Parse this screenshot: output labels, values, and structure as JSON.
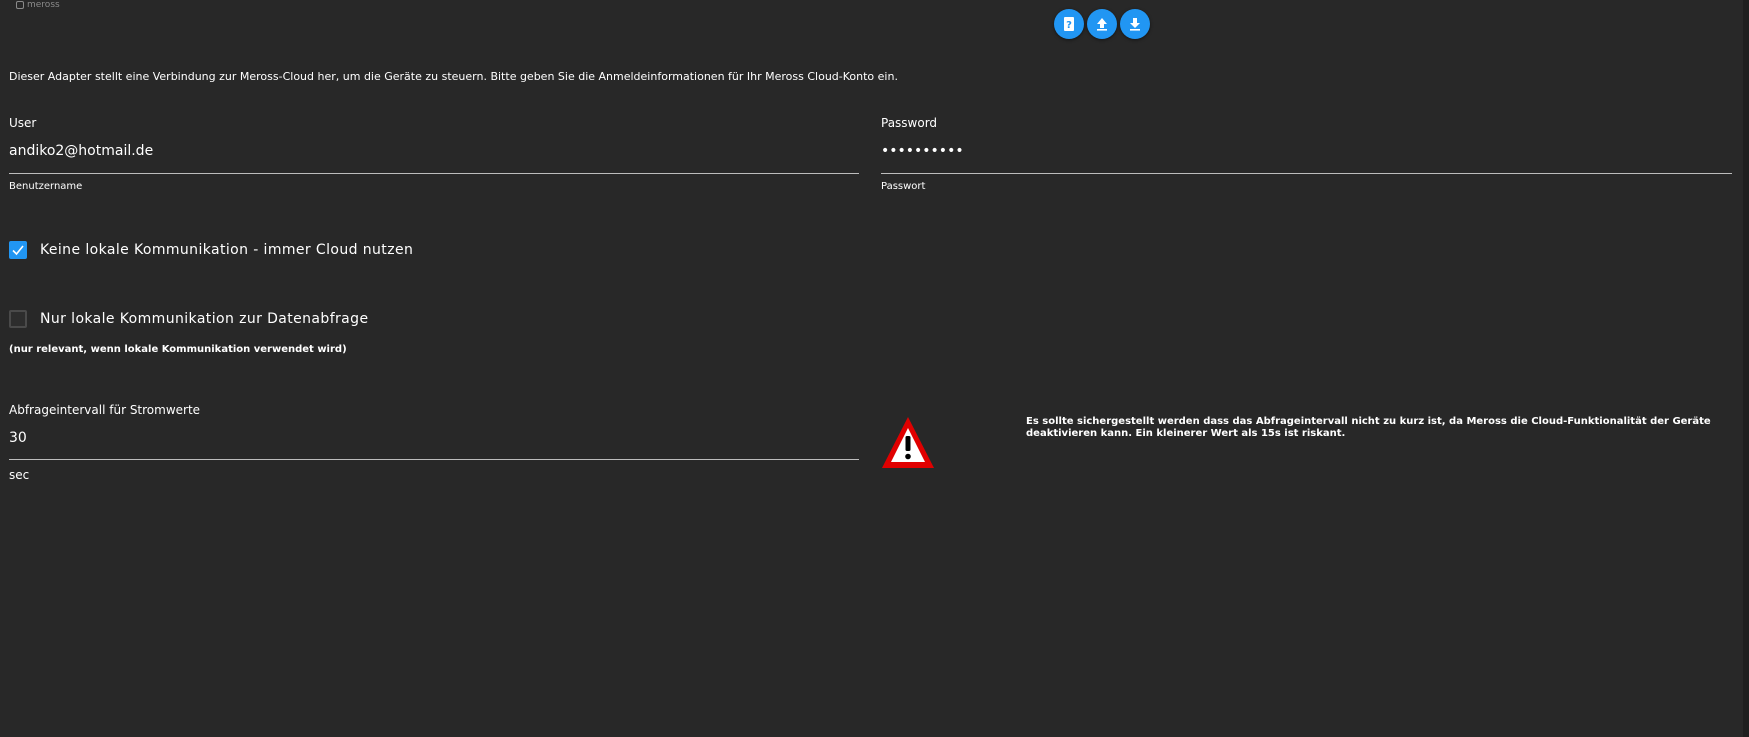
{
  "brand": {
    "name": "meross"
  },
  "toolbar": {
    "buttons": [
      {
        "icon": "help-book-icon",
        "title": "Help"
      },
      {
        "icon": "upload-icon",
        "title": "Upload"
      },
      {
        "icon": "download-icon",
        "title": "Download"
      }
    ]
  },
  "intro_text": "Dieser Adapter stellt eine Verbindung zur Meross-Cloud her, um die Geräte zu steuern. Bitte geben Sie die Anmeldeinformationen für Ihr Meross Cloud-Konto ein.",
  "user": {
    "label": "User",
    "value": "andiko2@hotmail.de",
    "helper": "Benutzername"
  },
  "password": {
    "label": "Password",
    "value": "••••••••••",
    "helper": "Passwort"
  },
  "checkboxes": [
    {
      "label": "Keine lokale Kommunikation - immer Cloud nutzen",
      "checked": true
    },
    {
      "label": "Nur lokale Kommunikation zur Datenabfrage",
      "checked": false
    }
  ],
  "local_note": "(nur relevant, wenn lokale Kommunikation verwendet wird)",
  "interval": {
    "label": "Abfrageintervall für Stromwerte",
    "value": "30",
    "unit": "sec"
  },
  "warning": {
    "icon": "warning-triangle-icon",
    "text": "Es sollte sichergestellt werden dass das Abfrageintervall nicht zu kurz ist, da Meross die Cloud-Funktionalität der Geräte deaktivieren kann. Ein kleinerer Wert als 15s ist riskant."
  },
  "colors": {
    "background": "#282828",
    "accent": "#2196f3",
    "warning_red": "#e00000"
  }
}
